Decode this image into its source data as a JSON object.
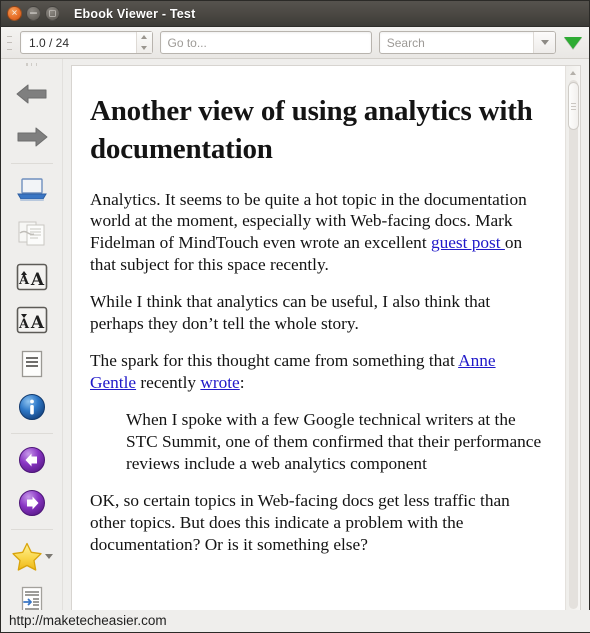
{
  "window": {
    "title": "Ebook Viewer - Test",
    "controls": [
      {
        "name": "close",
        "glyph": "✕"
      },
      {
        "name": "minimize",
        "glyph": "−"
      },
      {
        "name": "maximize",
        "glyph": "□"
      }
    ]
  },
  "toolbar": {
    "page_spinner": {
      "value": "1.0 / 24",
      "name": "page-position-spinner"
    },
    "goto": {
      "placeholder": "Go to...",
      "value": ""
    },
    "search": {
      "placeholder": "Search",
      "value": ""
    },
    "find_next_label": "find-next"
  },
  "sidebar": {
    "items": [
      {
        "name": "back-arrow-icon",
        "label": "Back"
      },
      {
        "name": "forward-arrow-icon",
        "label": "Forward"
      },
      {
        "name": "fullscreen-icon",
        "label": "Toggle full screen"
      },
      {
        "name": "copy-reference-icon",
        "label": "Copy to clipboard"
      },
      {
        "name": "increase-font-size-icon",
        "label": "Increase font size"
      },
      {
        "name": "decrease-font-size-icon",
        "label": "Decrease font size"
      },
      {
        "name": "table-of-contents-icon",
        "label": "Table of Contents"
      },
      {
        "name": "metadata-info-icon",
        "label": "Book metadata"
      },
      {
        "name": "previous-page-icon",
        "label": "Previous page"
      },
      {
        "name": "next-page-icon",
        "label": "Next page"
      },
      {
        "name": "bookmark-star-icon",
        "label": "Bookmark"
      },
      {
        "name": "reference-mode-icon",
        "label": "Reference mode"
      }
    ]
  },
  "document": {
    "heading": "Another view of using analytics with documentation",
    "paragraphs": [
      {
        "parts": [
          {
            "t": "Analytics. It seems to be quite a hot topic in the documentation world at the moment, especially with Web-facing docs. Mark Fidelman of MindTouch even wrote an excellent ",
            "link": false
          },
          {
            "t": "guest post ",
            "link": true
          },
          {
            "t": "on that subject for this space recently.",
            "link": false
          }
        ]
      },
      {
        "parts": [
          {
            "t": "While I think that analytics can be useful, I also think that perhaps they don’t tell the whole story.",
            "link": false
          }
        ]
      },
      {
        "parts": [
          {
            "t": "The spark for this thought came from something that  ",
            "link": false
          },
          {
            "t": "Anne Gentle",
            "link": true
          },
          {
            "t": " recently ",
            "link": false
          },
          {
            "t": "wrote",
            "link": true
          },
          {
            "t": ":",
            "link": false
          }
        ]
      }
    ],
    "blockquote": "When I spoke with a few Google technical writers at the STC Summit, one of them confirmed that their performance reviews include a web analytics component",
    "paragraphs_after": [
      {
        "parts": [
          {
            "t": "OK, so certain topics in Web-facing docs get less traffic than other topics. But does this indicate a problem with the documentation? Or is it something else?",
            "link": false
          }
        ]
      }
    ]
  },
  "watermark": {
    "text": "http://maketecheasier.com"
  },
  "colors": {
    "titlebar_top": "#56534e",
    "titlebar_bottom": "#3c3b37",
    "close_button": "#e8702a",
    "link": "#2019c9",
    "find_next_green": "#2eab33",
    "sidebar_bg": "#efeeec"
  }
}
